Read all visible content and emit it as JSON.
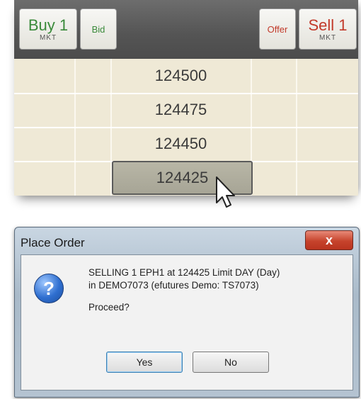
{
  "ladder": {
    "buy_label": "Buy 1",
    "buy_sub": "MKT",
    "bid_label": "Bid",
    "offer_label": "Offer",
    "sell_label": "Sell 1",
    "sell_sub": "MKT",
    "prices": [
      "124500",
      "124475",
      "124450",
      "124425"
    ],
    "selected_price": "124425",
    "colors": {
      "buy": "#3a8a3a",
      "sell": "#c23a2a"
    }
  },
  "dialog": {
    "title": "Place Order",
    "close_label": "x",
    "message_line1": "SELLING 1 EPH1 at 124425 Limit DAY (Day)",
    "message_line2": "in DEMO7073 (efutures Demo: TS7073)",
    "proceed": "Proceed?",
    "yes_label": "Yes",
    "no_label": "No",
    "icon": "question-icon"
  }
}
